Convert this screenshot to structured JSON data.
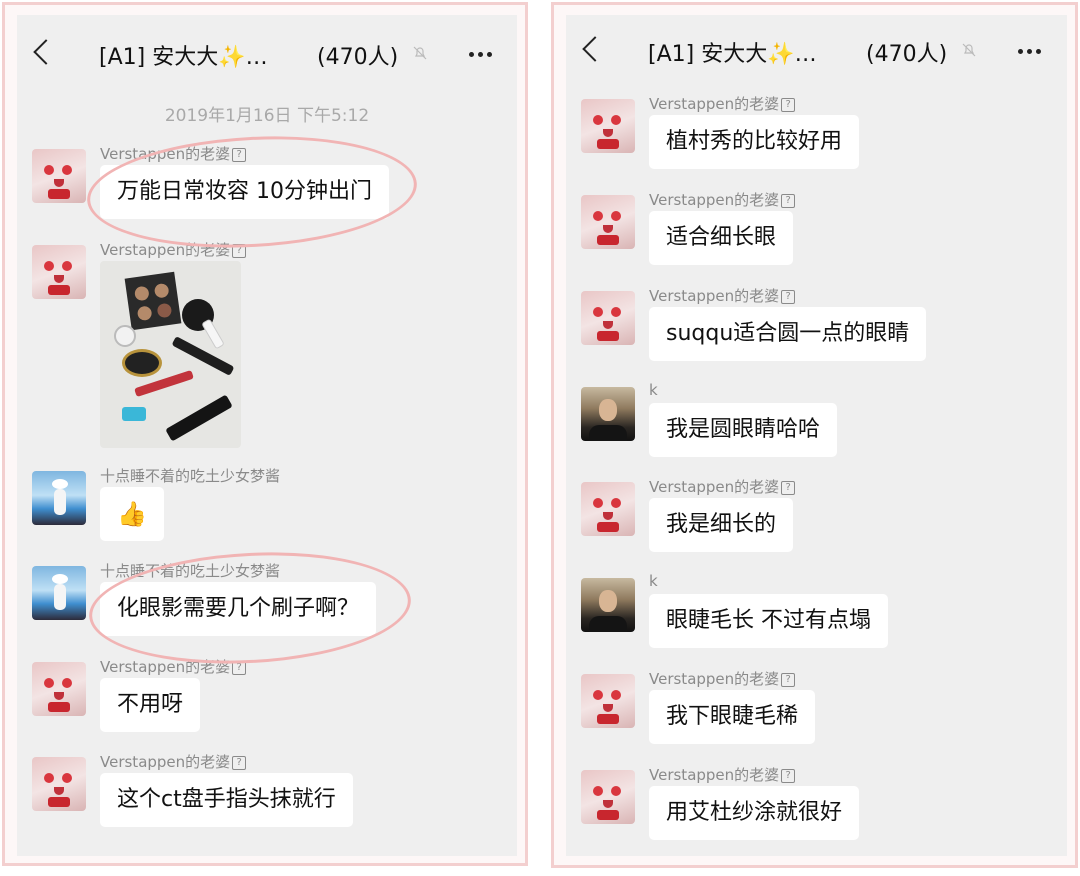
{
  "left": {
    "nav": {
      "back_label": "<",
      "title": "[A1] 安大大✨…",
      "count": "(470人)"
    },
    "timestamp": "2019年1月16日 下午5:12",
    "messages": [
      {
        "sender": "Verstappen的老婆",
        "avatar": "cat-avatar",
        "text": "万能日常妆容 10分钟出门"
      },
      {
        "sender": "Verstappen的老婆",
        "avatar": "cat-avatar",
        "image": "makeup-products-photo"
      },
      {
        "sender": "十点睡不着的吃土少女梦酱",
        "avatar": "beach-avatar",
        "emoji": "👍"
      },
      {
        "sender": "十点睡不着的吃土少女梦酱",
        "avatar": "beach-avatar",
        "text": "化眼影需要几个刷子啊？"
      },
      {
        "sender": "Verstappen的老婆",
        "avatar": "cat-avatar",
        "text": "不用呀"
      },
      {
        "sender": "Verstappen的老婆",
        "avatar": "cat-avatar",
        "text": "这个ct盘手指头抹就行"
      }
    ]
  },
  "right": {
    "nav": {
      "back_label": "<",
      "title": "[A1] 安大大✨…",
      "count": "(470人)"
    },
    "messages": [
      {
        "sender": "Verstappen的老婆",
        "avatar": "cat-avatar",
        "text": "植村秀的比较好用"
      },
      {
        "sender": "Verstappen的老婆",
        "avatar": "cat-avatar",
        "text": "适合细长眼"
      },
      {
        "sender": "Verstappen的老婆",
        "avatar": "cat-avatar",
        "text": "suqqu适合圆一点的眼睛"
      },
      {
        "sender": "k",
        "avatar": "person-avatar",
        "text": "我是圆眼睛哈哈"
      },
      {
        "sender": "Verstappen的老婆",
        "avatar": "cat-avatar",
        "text": "我是细长的"
      },
      {
        "sender": "k",
        "avatar": "person-avatar",
        "text": "眼睫毛长 不过有点塌"
      },
      {
        "sender": "Verstappen的老婆",
        "avatar": "cat-avatar",
        "text": "我下眼睫毛稀"
      },
      {
        "sender": "Verstappen的老婆",
        "avatar": "cat-avatar",
        "text": "用艾杜纱涂就很好"
      }
    ]
  },
  "colors": {
    "frame_border": "#f3cfcf",
    "chat_background": "#efefef",
    "bubble": "#ffffff",
    "annotation_circle": "#f1b4b4"
  }
}
